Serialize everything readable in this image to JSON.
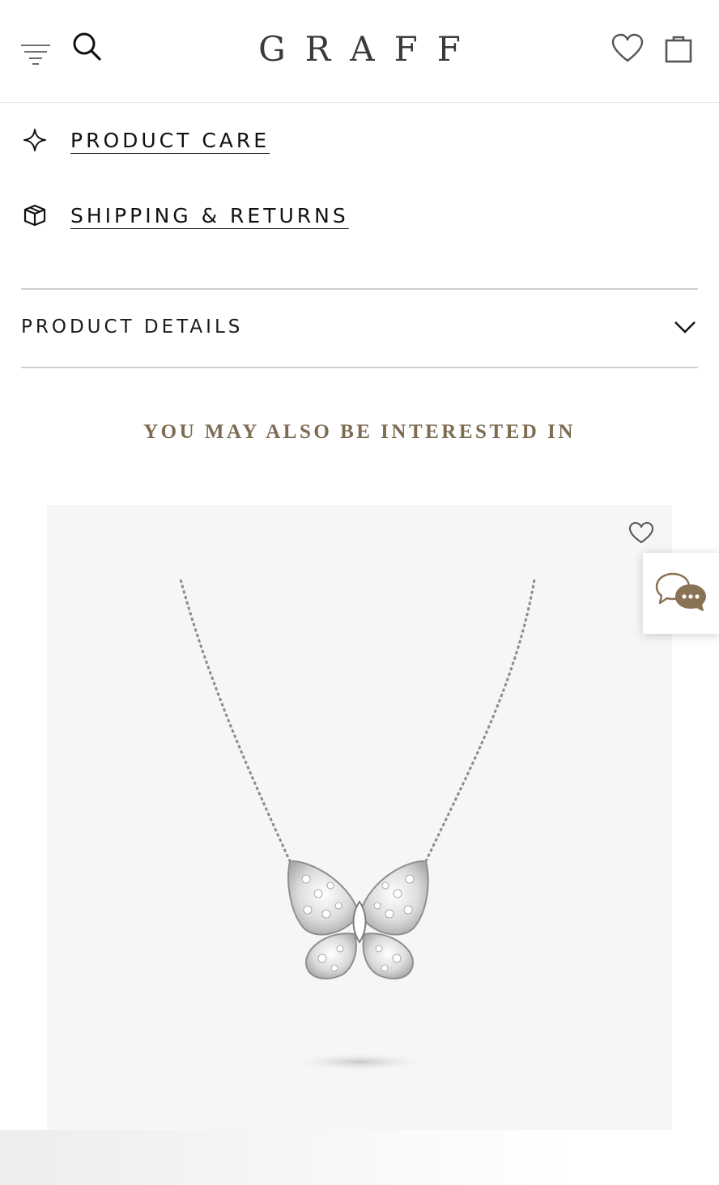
{
  "header": {
    "logo": "GRAFF",
    "menu_icon": "menu-icon",
    "search_icon": "search-icon",
    "wishlist_icon": "heart-icon",
    "bag_icon": "shopping-bag-icon"
  },
  "links": {
    "product_care": {
      "label": "PRODUCT CARE",
      "icon": "sparkle-icon"
    },
    "shipping_returns": {
      "label": "SHIPPING & RETURNS",
      "icon": "box-icon"
    }
  },
  "accordion": {
    "title": "PRODUCT DETAILS",
    "icon": "chevron-down-icon"
  },
  "recommendations": {
    "heading": "YOU MAY ALSO BE INTERESTED IN",
    "products": [
      {
        "image": "butterfly-diamond-pendant-necklace",
        "wishlist_icon": "heart-icon"
      }
    ]
  },
  "chat": {
    "icon": "chat-bubbles-icon"
  },
  "colors": {
    "heading_gold": "#7d6c52",
    "text": "#111111",
    "divider": "#cfcfcf",
    "card_bg": "#f7f5f5"
  }
}
